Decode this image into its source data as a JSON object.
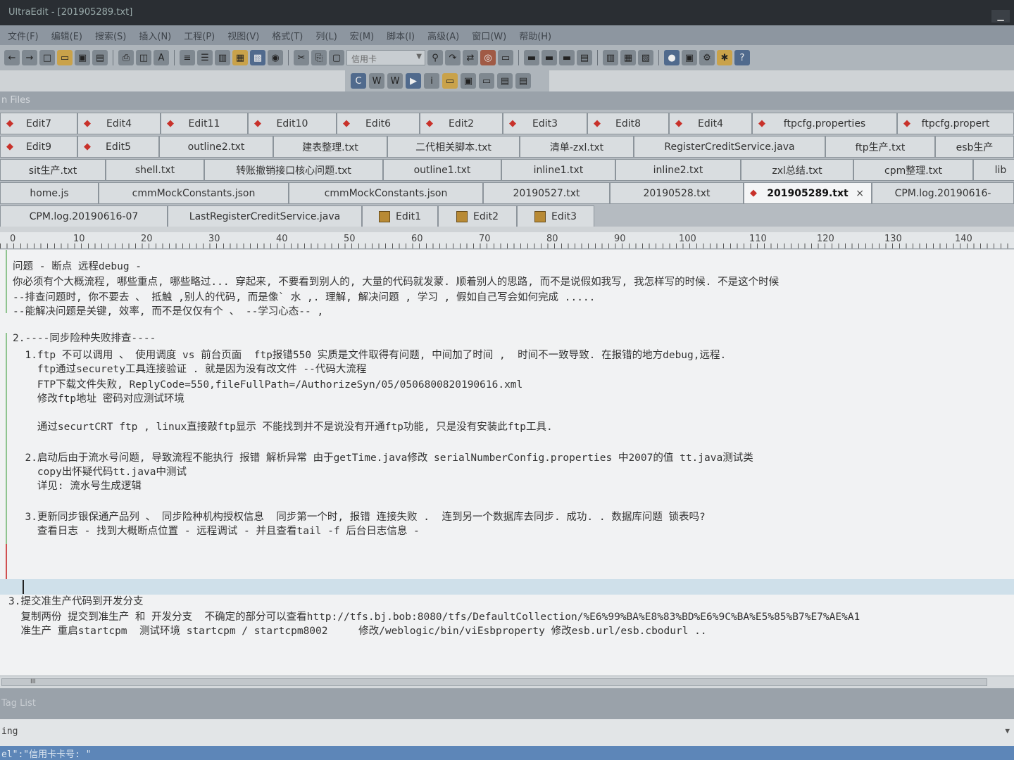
{
  "titlebar": {
    "title": "UltraEdit - [201905289.txt]",
    "minimize": "▁"
  },
  "menu": [
    "文件(F)",
    "编辑(E)",
    "搜索(S)",
    "插入(N)",
    "工程(P)",
    "视图(V)",
    "格式(T)",
    "列(L)",
    "宏(M)",
    "脚本(I)",
    "高级(A)",
    "窗口(W)",
    "帮助(H)"
  ],
  "toolbar": {
    "search_combo": "信用卡"
  },
  "panels": {
    "files_title": "n Files",
    "tag_list_title": "Tag List"
  },
  "tabs": {
    "row1": [
      "Edit7",
      "Edit4",
      "Edit11",
      "Edit10",
      "Edit6",
      "Edit2",
      "Edit3",
      "Edit8",
      "Edit4",
      "ftpcfg.properties",
      "ftpcfg.propert"
    ],
    "row2": [
      "Edit9",
      "Edit5",
      "outline2.txt",
      "建表整理.txt",
      "二代相关脚本.txt",
      "清单-zxl.txt",
      "RegisterCreditService.java",
      "ftp生产.txt",
      "esb生产"
    ],
    "row3": [
      "sit生产.txt",
      "shell.txt",
      "转账撤销接口核心问题.txt",
      "outline1.txt",
      "inline1.txt",
      "inline2.txt",
      "zxl总结.txt",
      "cpm整理.txt",
      "lib"
    ],
    "row4": [
      "home.js",
      "cmmMockConstants.json",
      "cmmMockConstants.json",
      "20190527.txt",
      "20190528.txt",
      "201905289.txt",
      "CPM.log.20190616-"
    ],
    "row5": [
      "CPM.log.20190616-07",
      "LastRegisterCreditService.java",
      "Edit1",
      "Edit2",
      "Edit3"
    ],
    "active_close": "×"
  },
  "ruler": [
    "0",
    "10",
    "20",
    "30",
    "40",
    "50",
    "60",
    "70",
    "80",
    "90",
    "100",
    "110",
    "120",
    "130",
    "140"
  ],
  "editor": {
    "lines": [
      "问题 - 断点 远程debug -",
      "你必须有个大概流程, 哪些重点, 哪些略过... 穿起来, 不要看到别人的, 大量的代码就发蒙. 顺着别人的思路, 而不是说假如我写, 我怎样写的时候. 不是这个时候",
      "--排查问题时, 你不要去 、 抵触 ,别人的代码, 而是像` 水 ,. 理解, 解决问题 , 学习 , 假如自己写会如何完成 .....",
      "--能解决问题是关键, 效率, 而不是仅仅有个 、 --学习心态-- ,",
      "2.----同步险种失败排查----",
      "  1.ftp 不可以调用 、 使用调度 vs 前台页面  ftp报错550 实质是文件取得有问题, 中间加了时间 ,  时间不一致导致. 在报错的地方debug,远程.",
      "    ftp通过securety工具连接验证 . 就是因为没有改文件 --代码大流程",
      "    FTP下载文件失败, ReplyCode=550,fileFullPath=/AuthorizeSyn/05/0506800820190616.xml",
      "    修改ftp地址 密码对应测试环境",
      "    通过securtCRT ftp , linux直接敲ftp显示 不能找到并不是说没有开通ftp功能, 只是没有安装此ftp工具.",
      "  2.启动后由于流水号问题, 导致流程不能执行 报错 解析异常 由于getTime.java修改 serialNumberConfig.properties 中2007的值 tt.java测试类",
      "    copy出怀疑代码tt.java中测试",
      "    详见: 流水号生成逻辑",
      "  3.更新同步银保通产品列 、 同步险种机构授权信息  同步第一个时, 报错 连接失败 .  连到另一个数据库去同步. 成功. . 数据库问题 锁表吗?",
      "    查看日志 - 找到大概断点位置 - 远程调试 - 并且查看tail -f 后台日志信息 -",
      "3.提交准生产代码到开发分支",
      "  复制两份 提交到准生产 和 开发分支  不确定的部分可以查看http://tfs.bj.bob:8080/tfs/DefaultCollection/%E6%99%BA%E8%83%BD%E6%9C%BA%E5%85%B7%E7%AE%A1",
      "  准生产 重启startcpm  测试环境 startcpm / startcpm8002     修改/weblogic/bin/viEsbproperty 修改esb.url/esb.cbodurl .."
    ]
  },
  "hscroll": {
    "grip": "III"
  },
  "bottom": {
    "output": "ing",
    "dropdown": "▼"
  },
  "status": {
    "text": "el\":\"信用卡卡号: \""
  }
}
